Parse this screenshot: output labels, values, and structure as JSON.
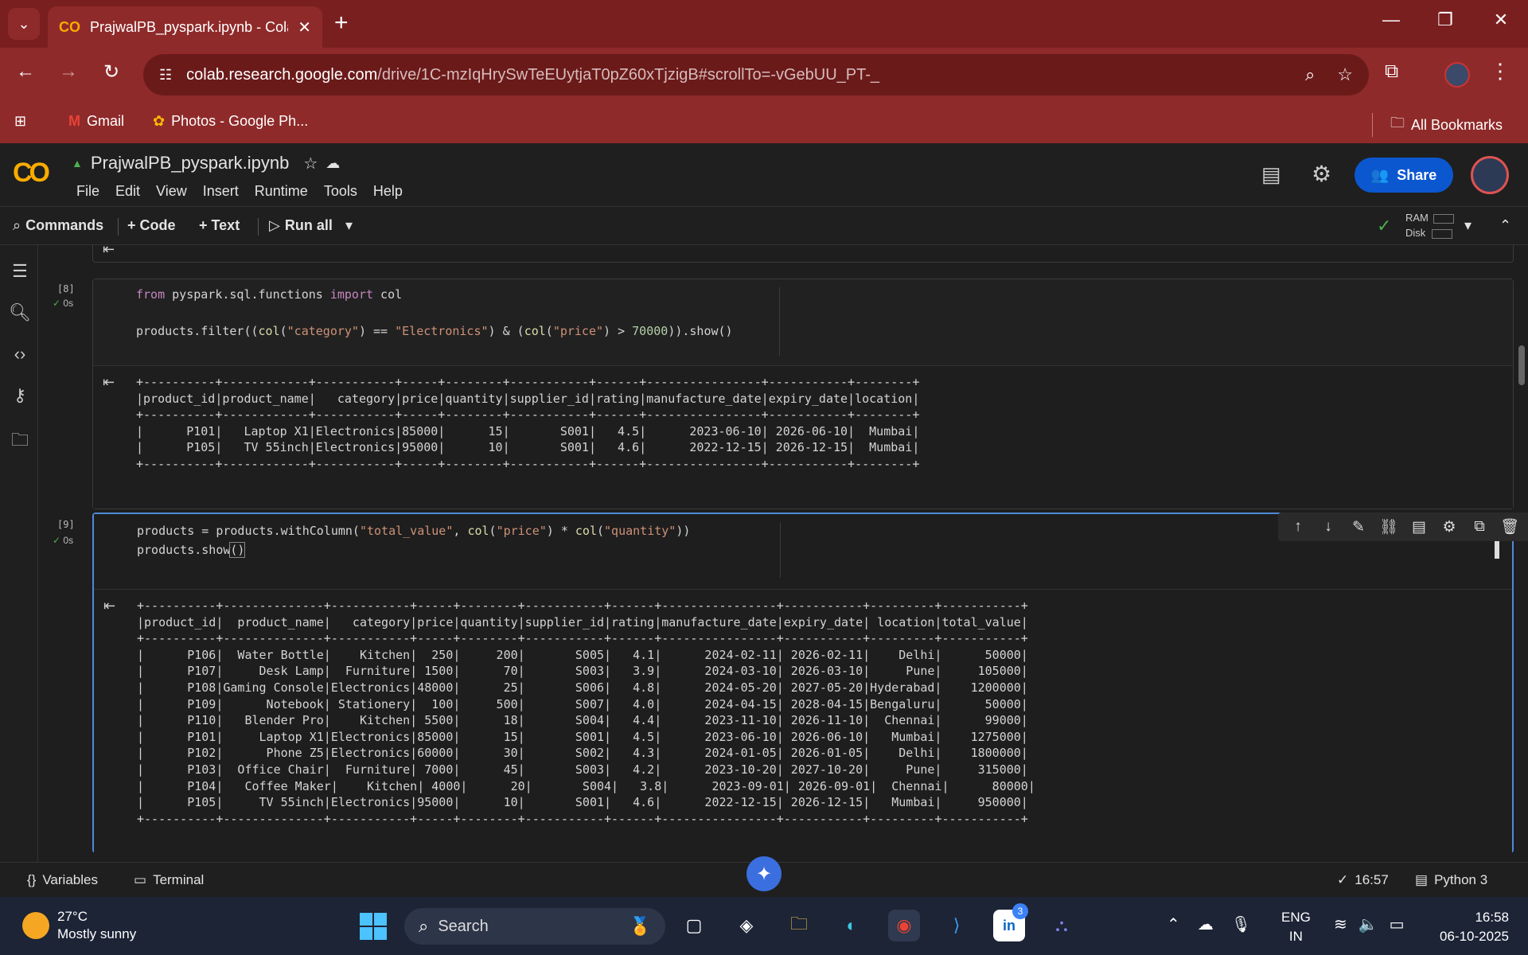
{
  "browser": {
    "tab_title": "PrajwalPB_pyspark.ipynb - Colab",
    "url_host": "colab.research.google.com",
    "url_path": "/drive/1C-mzIqHrySwTeEUytjaT0pZ60xTjzigB#scrollTo=-vGebUU_PT-_",
    "bookmarks": [
      "Gmail",
      "Photos - Google Ph..."
    ],
    "all_bookmarks": "All Bookmarks"
  },
  "colab": {
    "notebook_name": "PrajwalPB_pyspark.ipynb",
    "menus": [
      "File",
      "Edit",
      "View",
      "Insert",
      "Runtime",
      "Tools",
      "Help"
    ],
    "share_label": "Share"
  },
  "toolbar": {
    "commands": "Commands",
    "code": "+ Code",
    "text": "+ Text",
    "run_all": "Run all",
    "ram": "RAM",
    "disk": "Disk"
  },
  "cells": [
    {
      "count": "[8]",
      "time": "0s",
      "code": [
        "from pyspark.sql.functions import col",
        "",
        "products.filter((col(\"category\") == \"Electronics\") & (col(\"price\") > 70000)).show()"
      ],
      "output": "+----------+------------+-----------+-----+--------+-----------+------+----------------+-----------+--------+\n|product_id|product_name|   category|price|quantity|supplier_id|rating|manufacture_date|expiry_date|location|\n+----------+------------+-----------+-----+--------+-----------+------+----------------+-----------+--------+\n|      P101|   Laptop X1|Electronics|85000|      15|       S001|   4.5|      2023-06-10| 2026-06-10|  Mumbai|\n|      P105|   TV 55inch|Electronics|95000|      10|       S001|   4.6|      2022-12-15| 2026-12-15|  Mumbai|\n+----------+------------+-----------+-----+--------+-----------+------+----------------+-----------+--------+"
    },
    {
      "count": "[9]",
      "time": "0s",
      "code": [
        "products = products.withColumn(\"total_value\", col(\"price\") * col(\"quantity\"))",
        "products.show()"
      ],
      "output": "+----------+--------------+-----------+-----+--------+-----------+------+----------------+-----------+---------+-----------+\n|product_id|  product_name|   category|price|quantity|supplier_id|rating|manufacture_date|expiry_date| location|total_value|\n+----------+--------------+-----------+-----+--------+-----------+------+----------------+-----------+---------+-----------+\n|      P106|  Water Bottle|    Kitchen|  250|     200|       S005|   4.1|      2024-02-11| 2026-02-11|    Delhi|      50000|\n|      P107|     Desk Lamp|  Furniture| 1500|      70|       S003|   3.9|      2024-03-10| 2026-03-10|     Pune|     105000|\n|      P108|Gaming Console|Electronics|48000|      25|       S006|   4.8|      2024-05-20| 2027-05-20|Hyderabad|    1200000|\n|      P109|      Notebook| Stationery|  100|     500|       S007|   4.0|      2024-04-15| 2028-04-15|Bengaluru|      50000|\n|      P110|   Blender Pro|    Kitchen| 5500|      18|       S004|   4.4|      2023-11-10| 2026-11-10|  Chennai|      99000|\n|      P101|     Laptop X1|Electronics|85000|      15|       S001|   4.5|      2023-06-10| 2026-06-10|   Mumbai|    1275000|\n|      P102|      Phone Z5|Electronics|60000|      30|       S002|   4.3|      2024-01-05| 2026-01-05|    Delhi|    1800000|\n|      P103|  Office Chair|  Furniture| 7000|      45|       S003|   4.2|      2023-10-20| 2027-10-20|     Pune|     315000|\n|      P104|   Coffee Maker|    Kitchen| 4000|      20|       S004|   3.8|      2023-09-01| 2026-09-01|  Chennai|      80000|\n|      P105|     TV 55inch|Electronics|95000|      10|       S001|   4.6|      2022-12-15| 2026-12-15|   Mumbai|     950000|\n+----------+--------------+-----------+-----+--------+-----------+------+----------------+-----------+---------+-----------+"
    }
  ],
  "statusbar": {
    "variables": "Variables",
    "terminal": "Terminal",
    "last_run": "16:57",
    "kernel": "Python 3"
  },
  "taskbar": {
    "temp": "27°C",
    "weather": "Mostly sunny",
    "search": "Search",
    "linkedin_badge": "3",
    "lang1": "ENG",
    "lang2": "IN",
    "time": "16:58",
    "date": "06-10-2025"
  }
}
